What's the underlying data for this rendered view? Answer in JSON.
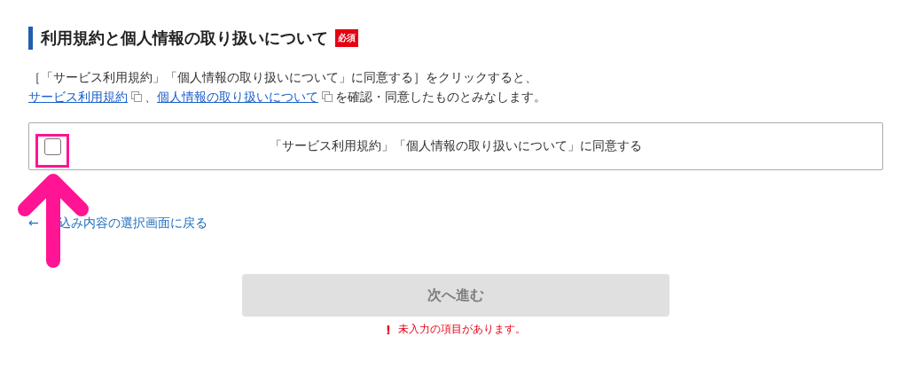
{
  "section": {
    "title": "利用規約と個人情報の取り扱いについて",
    "required_badge": "必須"
  },
  "description": {
    "line_1": "［「サービス利用規約」「個人情報の取り扱いについて」に同意する］をクリックすると、",
    "links": [
      {
        "text": "サービス利用規約"
      },
      {
        "text": "個人情報の取り扱いについて"
      }
    ],
    "separator": "、",
    "suffix": "を確認・同意したものとみなします。"
  },
  "agreement": {
    "label": "「サービス利用規約」「個人情報の取り扱いについて」に同意する",
    "checked": false
  },
  "back_link": {
    "arrow": "←",
    "text": "込み内容の選択画面に戻る"
  },
  "next_button": {
    "label": "次へ進む",
    "disabled": true
  },
  "error": {
    "icon": "!",
    "text": "未入力の項目があります。"
  }
}
